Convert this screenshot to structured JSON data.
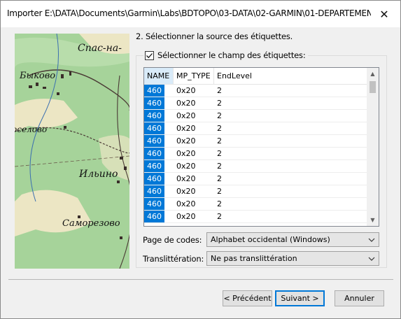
{
  "window": {
    "title": "Importer E:\\DATA\\Documents\\Garmin\\Labs\\BDTOPO\\03-DATA\\02-GARMIN\\01-DEPARTEMENT\\...",
    "close_glyph": "✕"
  },
  "map": {
    "labels": [
      "Спас-на-",
      "Быково",
      "оселово",
      "Ильино",
      "Саморезово"
    ],
    "colors": {
      "land": "#a6d39a",
      "road": "#4a3a35",
      "field": "#ece6c4"
    }
  },
  "step_title": "2. Sélectionner la source des étiquettes.",
  "select_field": {
    "label": "Sélectionner le champ des étiquettes:",
    "checked": true
  },
  "table": {
    "columns": [
      "NAME",
      "MP_TYPE",
      "EndLevel"
    ],
    "rows": [
      [
        "460",
        "0x20",
        "2"
      ],
      [
        "460",
        "0x20",
        "2"
      ],
      [
        "460",
        "0x20",
        "2"
      ],
      [
        "460",
        "0x20",
        "2"
      ],
      [
        "460",
        "0x20",
        "2"
      ],
      [
        "460",
        "0x20",
        "2"
      ],
      [
        "460",
        "0x20",
        "2"
      ],
      [
        "460",
        "0x20",
        "2"
      ],
      [
        "460",
        "0x20",
        "2"
      ],
      [
        "460",
        "0x20",
        "2"
      ],
      [
        "460",
        "0x20",
        "2"
      ]
    ],
    "selected_color": "#0078d7"
  },
  "codepage": {
    "label": "Page de codes:",
    "value": "Alphabet occidental (Windows)"
  },
  "translit": {
    "label": "Translittération:",
    "value": "Ne pas translittération"
  },
  "buttons": {
    "prev": "< Précédent",
    "next": "Suivant >",
    "cancel": "Annuler"
  }
}
